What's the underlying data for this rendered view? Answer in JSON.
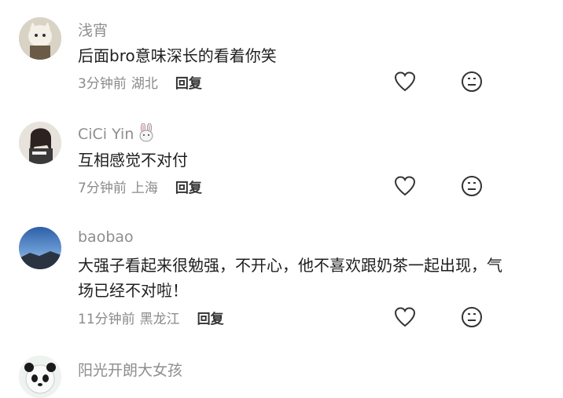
{
  "comments": [
    {
      "username": "浅宵",
      "text": "后面bro意味深长的看着你笑",
      "time": "3分钟前",
      "location": "湖北",
      "reply": "回复"
    },
    {
      "username": "CiCi Yin",
      "username_emoji": "rabbit-icon",
      "text": "互相感觉不对付",
      "time": "7分钟前",
      "location": "上海",
      "reply": "回复"
    },
    {
      "username": "baobao",
      "text": "大强子看起来很勉强，不开心，他不喜欢跟奶茶一起出现，气场已经不对啦！",
      "time": "11分钟前",
      "location": "黑龙江",
      "reply": "回复"
    },
    {
      "username": "阳光开朗大女孩",
      "text": "",
      "time": "",
      "location": "",
      "reply": ""
    }
  ],
  "icons": {
    "like": "heart-outline-icon",
    "dislike": "neutral-face-icon"
  },
  "colors": {
    "username": "#8e8e8e",
    "meta": "#8a8a8a",
    "icon": "#333333"
  }
}
